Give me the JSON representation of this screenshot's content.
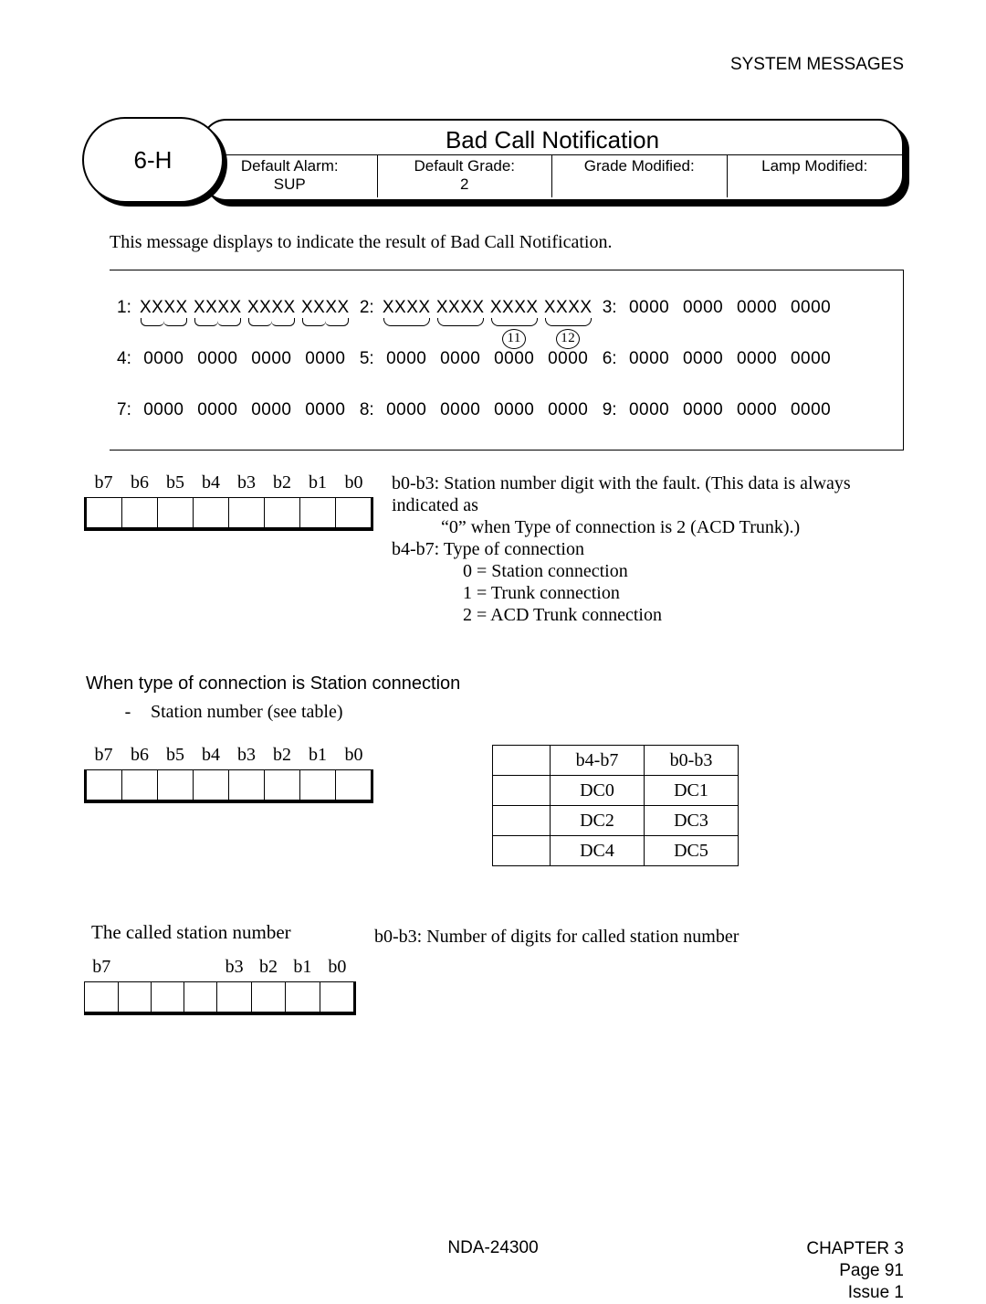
{
  "header_right": "SYSTEM MESSAGES",
  "title": {
    "code": "6-H",
    "heading": "Bad Call Notification",
    "cells": {
      "alarm_label": "Default Alarm:",
      "alarm_value": "SUP",
      "grade_label": "Default Grade:",
      "grade_value": "2",
      "gm_label": "Grade Modified:",
      "lm_label": "Lamp Modified:"
    }
  },
  "intro": "This message displays to indicate the result of Bad Call Notification.",
  "frame": {
    "groups": [
      {
        "label": "1:",
        "words": [
          "XXXX",
          "XXXX",
          "XXXX",
          "XXXX"
        ],
        "style": "split"
      },
      {
        "label": "2:",
        "words": [
          "XXXX",
          "XXXX",
          "XXXX",
          "XXXX"
        ],
        "style": "half",
        "circles": [
          "",
          "",
          "11",
          "12"
        ]
      },
      {
        "label": "3:",
        "words": [
          "0000",
          "0000",
          "0000",
          "0000"
        ],
        "style": ""
      },
      {
        "label": "4:",
        "words": [
          "0000",
          "0000",
          "0000",
          "0000"
        ],
        "style": ""
      },
      {
        "label": "5:",
        "words": [
          "0000",
          "0000",
          "0000",
          "0000"
        ],
        "style": ""
      },
      {
        "label": "6:",
        "words": [
          "0000",
          "0000",
          "0000",
          "0000"
        ],
        "style": ""
      },
      {
        "label": "7:",
        "words": [
          "0000",
          "0000",
          "0000",
          "0000"
        ],
        "style": ""
      },
      {
        "label": "8:",
        "words": [
          "0000",
          "0000",
          "0000",
          "0000"
        ],
        "style": ""
      },
      {
        "label": "9:",
        "words": [
          "0000",
          "0000",
          "0000",
          "0000"
        ],
        "style": ""
      }
    ]
  },
  "bits": [
    "b7",
    "b6",
    "b5",
    "b4",
    "b3",
    "b2",
    "b1",
    "b0"
  ],
  "first_byte_notes": {
    "l1": "b0-b3: Station number digit with the fault. (This data is always indicated as",
    "l1b": "“0” when Type of connection is 2 (ACD Trunk).)",
    "l2": "b4-b7: Type of connection",
    "l3": "0 = Station connection",
    "l4": "1 = Trunk connection",
    "l5": "2 = ACD Trunk connection"
  },
  "section_station": {
    "title": "When type of connection is Station connection",
    "sub": "Station number (see table)"
  },
  "dc_table": {
    "headers": [
      "b4-b7",
      "b0-b3"
    ],
    "rows": [
      [
        "DC0",
        "DC1"
      ],
      [
        "DC2",
        "DC3"
      ],
      [
        "DC4",
        "DC5"
      ]
    ]
  },
  "called_section": {
    "title": "The called station number",
    "note": "b0-b3: Number of digits for called station number",
    "bits": [
      "b7",
      "",
      "",
      "",
      "b3",
      "b2",
      "b1",
      "b0"
    ]
  },
  "footer": {
    "center": "NDA-24300",
    "chapter": "CHAPTER 3",
    "page": "Page 91",
    "issue": "Issue 1"
  },
  "chart_data": {
    "type": "table",
    "title": "System message 6-H — Bad Call Notification data layout",
    "byte_fields": {
      "b0-b3": "Station number digit with the fault (always 0 when Type of connection is 2, ACD Trunk)",
      "b4-b7": {
        "name": "Type of connection",
        "values": {
          "0": "Station connection",
          "1": "Trunk connection",
          "2": "ACD Trunk connection"
        }
      }
    },
    "station_number_bytes": [
      {
        "b4-b7": "DC0",
        "b0-b3": "DC1"
      },
      {
        "b4-b7": "DC2",
        "b0-b3": "DC3"
      },
      {
        "b4-b7": "DC4",
        "b0-b3": "DC5"
      }
    ],
    "called_station_byte": {
      "b0-b3": "Number of digits for called station number"
    }
  }
}
